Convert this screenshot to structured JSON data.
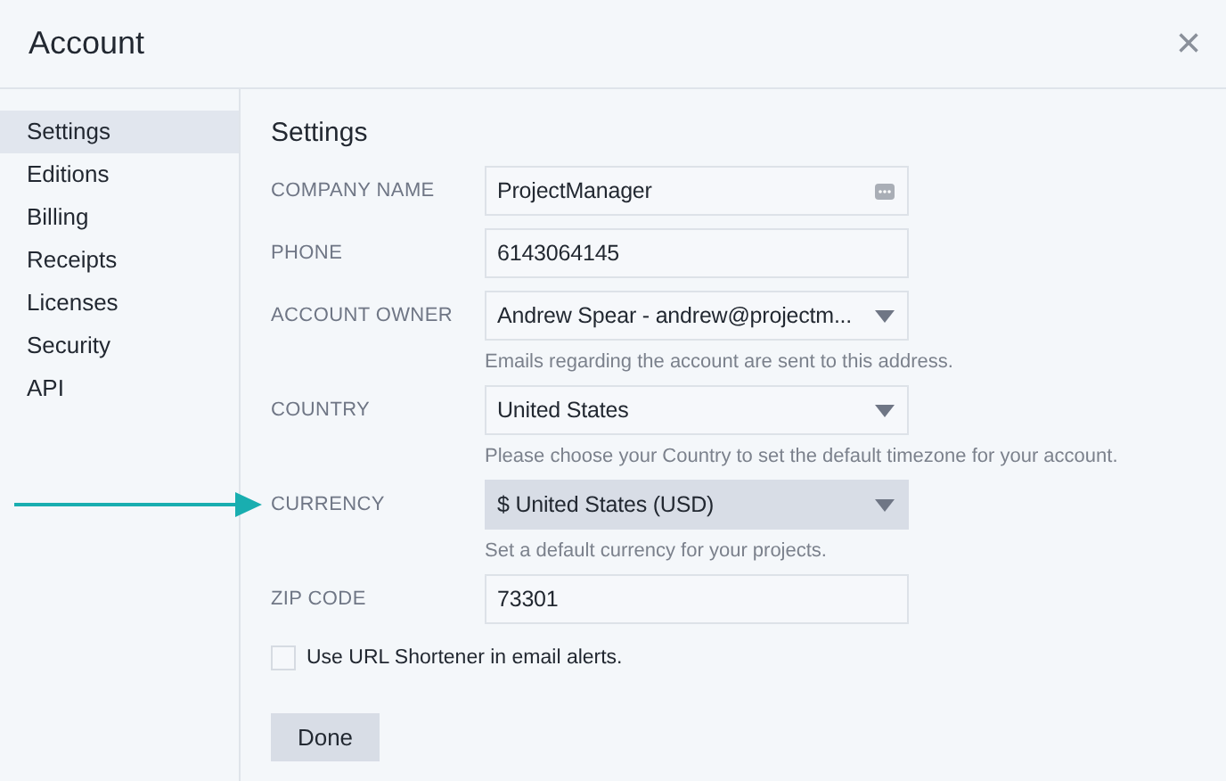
{
  "window": {
    "title": "Account",
    "close": "×"
  },
  "sidebar": {
    "items": [
      {
        "label": "Settings",
        "selected": true
      },
      {
        "label": "Editions",
        "selected": false
      },
      {
        "label": "Billing",
        "selected": false
      },
      {
        "label": "Receipts",
        "selected": false
      },
      {
        "label": "Licenses",
        "selected": false
      },
      {
        "label": "Security",
        "selected": false
      },
      {
        "label": "API",
        "selected": false
      }
    ]
  },
  "content": {
    "title": "Settings",
    "fields": [
      {
        "label": "COMPANY NAME",
        "kind": "text",
        "value": "ProjectManager",
        "autofill_icon": true,
        "highlighted": false
      },
      {
        "label": "PHONE",
        "kind": "text",
        "value": "6143064145",
        "autofill_icon": false,
        "highlighted": false
      },
      {
        "label": "ACCOUNT OWNER",
        "kind": "select",
        "value": "Andrew Spear - andrew@projectm...",
        "help": "Emails regarding the account are sent to this address.",
        "highlighted": false
      },
      {
        "label": "COUNTRY",
        "kind": "select",
        "value": "United States",
        "help": "Please choose your Country to set the default timezone for your account.",
        "highlighted": false
      },
      {
        "label": "CURRENCY",
        "kind": "select",
        "value": "$ United States (USD)",
        "help": "Set a default currency for your projects.",
        "highlighted": true,
        "pointer_arrow": true
      },
      {
        "label": "ZIP CODE",
        "kind": "text",
        "value": "73301",
        "autofill_icon": false,
        "highlighted": false
      }
    ],
    "checkbox": {
      "label": "Use URL Shortener in email alerts.",
      "checked": false
    },
    "button": "Done"
  }
}
